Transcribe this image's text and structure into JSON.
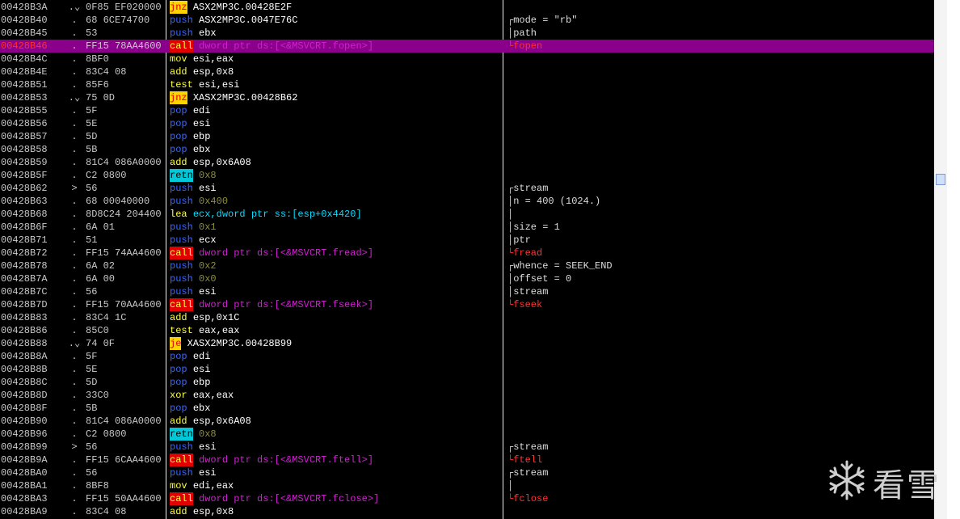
{
  "rows": [
    {
      "addr": "00428B3A",
      "mark": ".⌄",
      "hex": "0F85 EF020000",
      "mnemonic": "jnz",
      "kind": "jmp",
      "operands": "ASX2MP3C.00428E2F",
      "opclass": "plain",
      "comment": "",
      "cmtclass": ""
    },
    {
      "addr": "00428B40",
      "mark": ".",
      "hex": "68 6CE74700",
      "mnemonic": "push",
      "kind": "push",
      "operands": "ASX2MP3C.0047E76C",
      "opclass": "plain",
      "comment": "┌mode = \"rb\"",
      "cmtclass": "bracket"
    },
    {
      "addr": "00428B45",
      "mark": ".",
      "hex": "53",
      "mnemonic": "push",
      "kind": "push",
      "operands": "ebx",
      "opclass": "plain",
      "comment": "│path",
      "cmtclass": "bracket"
    },
    {
      "addr": "00428B46",
      "mark": ".",
      "hex": "FF15 78AA4600",
      "mnemonic": "call",
      "kind": "call",
      "operands": "dword ptr ds:[<&MSVCRT.fopen>]",
      "opclass": "call",
      "comment": "└fopen",
      "cmtclass": "func",
      "selected": true
    },
    {
      "addr": "00428B4C",
      "mark": ".",
      "hex": "8BF0",
      "mnemonic": "mov",
      "kind": "def",
      "operands": "esi,eax",
      "opclass": "plain",
      "comment": "",
      "cmtclass": ""
    },
    {
      "addr": "00428B4E",
      "mark": ".",
      "hex": "83C4 08",
      "mnemonic": "add",
      "kind": "def",
      "operands": "esp,0x8",
      "opclass": "plain",
      "comment": "",
      "cmtclass": ""
    },
    {
      "addr": "00428B51",
      "mark": ".",
      "hex": "85F6",
      "mnemonic": "test",
      "kind": "def",
      "operands": "esi,esi",
      "opclass": "plain",
      "comment": "",
      "cmtclass": ""
    },
    {
      "addr": "00428B53",
      "mark": ".⌄",
      "hex": "75 0D",
      "mnemonic": "jnz",
      "kind": "jmp",
      "operands": "XASX2MP3C.00428B62",
      "opclass": "plain",
      "comment": "",
      "cmtclass": ""
    },
    {
      "addr": "00428B55",
      "mark": ".",
      "hex": "5F",
      "mnemonic": "pop",
      "kind": "push",
      "operands": "edi",
      "opclass": "plain",
      "comment": "",
      "cmtclass": ""
    },
    {
      "addr": "00428B56",
      "mark": ".",
      "hex": "5E",
      "mnemonic": "pop",
      "kind": "push",
      "operands": "esi",
      "opclass": "plain",
      "comment": "",
      "cmtclass": ""
    },
    {
      "addr": "00428B57",
      "mark": ".",
      "hex": "5D",
      "mnemonic": "pop",
      "kind": "push",
      "operands": "ebp",
      "opclass": "plain",
      "comment": "",
      "cmtclass": ""
    },
    {
      "addr": "00428B58",
      "mark": ".",
      "hex": "5B",
      "mnemonic": "pop",
      "kind": "push",
      "operands": "ebx",
      "opclass": "plain",
      "comment": "",
      "cmtclass": ""
    },
    {
      "addr": "00428B59",
      "mark": ".",
      "hex": "81C4 086A0000",
      "mnemonic": "add",
      "kind": "def",
      "operands": "esp,0x6A08",
      "opclass": "plain",
      "comment": "",
      "cmtclass": ""
    },
    {
      "addr": "00428B5F",
      "mark": ".",
      "hex": "C2 0800",
      "mnemonic": "retn",
      "kind": "retn",
      "operands": "0x8",
      "opclass": "num",
      "comment": "",
      "cmtclass": ""
    },
    {
      "addr": "00428B62",
      "mark": ">",
      "hex": "56",
      "mnemonic": "push",
      "kind": "push",
      "operands": "esi",
      "opclass": "plain",
      "comment": "┌stream",
      "cmtclass": "bracket"
    },
    {
      "addr": "00428B63",
      "mark": ".",
      "hex": "68 00040000",
      "mnemonic": "push",
      "kind": "push",
      "operands": "0x400",
      "opclass": "num",
      "comment": "│n = 400 (1024.)",
      "cmtclass": "bracket"
    },
    {
      "addr": "00428B68",
      "mark": ".",
      "hex": "8D8C24 204400",
      "mnemonic": "lea",
      "kind": "def",
      "operands": "ecx,dword ptr ss:[esp+0x4420]",
      "opclass": "reg",
      "comment": "│",
      "cmtclass": "bracket"
    },
    {
      "addr": "00428B6F",
      "mark": ".",
      "hex": "6A 01",
      "mnemonic": "push",
      "kind": "push",
      "operands": "0x1",
      "opclass": "num",
      "comment": "│size = 1",
      "cmtclass": "bracket"
    },
    {
      "addr": "00428B71",
      "mark": ".",
      "hex": "51",
      "mnemonic": "push",
      "kind": "push",
      "operands": "ecx",
      "opclass": "plain",
      "comment": "│ptr",
      "cmtclass": "bracket"
    },
    {
      "addr": "00428B72",
      "mark": ".",
      "hex": "FF15 74AA4600",
      "mnemonic": "call",
      "kind": "call",
      "operands": "dword ptr ds:[<&MSVCRT.fread>]",
      "opclass": "call",
      "comment": "└fread",
      "cmtclass": "func"
    },
    {
      "addr": "00428B78",
      "mark": ".",
      "hex": "6A 02",
      "mnemonic": "push",
      "kind": "push",
      "operands": "0x2",
      "opclass": "num",
      "comment": "┌whence = SEEK_END",
      "cmtclass": "bracket"
    },
    {
      "addr": "00428B7A",
      "mark": ".",
      "hex": "6A 00",
      "mnemonic": "push",
      "kind": "push",
      "operands": "0x0",
      "opclass": "num",
      "comment": "│offset = 0",
      "cmtclass": "bracket"
    },
    {
      "addr": "00428B7C",
      "mark": ".",
      "hex": "56",
      "mnemonic": "push",
      "kind": "push",
      "operands": "esi",
      "opclass": "plain",
      "comment": "│stream",
      "cmtclass": "bracket"
    },
    {
      "addr": "00428B7D",
      "mark": ".",
      "hex": "FF15 70AA4600",
      "mnemonic": "call",
      "kind": "call",
      "operands": "dword ptr ds:[<&MSVCRT.fseek>]",
      "opclass": "call",
      "comment": "└fseek",
      "cmtclass": "func"
    },
    {
      "addr": "00428B83",
      "mark": ".",
      "hex": "83C4 1C",
      "mnemonic": "add",
      "kind": "def",
      "operands": "esp,0x1C",
      "opclass": "plain",
      "comment": "",
      "cmtclass": ""
    },
    {
      "addr": "00428B86",
      "mark": ".",
      "hex": "85C0",
      "mnemonic": "test",
      "kind": "def",
      "operands": "eax,eax",
      "opclass": "plain",
      "comment": "",
      "cmtclass": ""
    },
    {
      "addr": "00428B88",
      "mark": ".⌄",
      "hex": "74 0F",
      "mnemonic": "je",
      "kind": "jmp",
      "operands": "XASX2MP3C.00428B99",
      "opclass": "plain",
      "comment": "",
      "cmtclass": ""
    },
    {
      "addr": "00428B8A",
      "mark": ".",
      "hex": "5F",
      "mnemonic": "pop",
      "kind": "push",
      "operands": "edi",
      "opclass": "plain",
      "comment": "",
      "cmtclass": ""
    },
    {
      "addr": "00428B8B",
      "mark": ".",
      "hex": "5E",
      "mnemonic": "pop",
      "kind": "push",
      "operands": "esi",
      "opclass": "plain",
      "comment": "",
      "cmtclass": ""
    },
    {
      "addr": "00428B8C",
      "mark": ".",
      "hex": "5D",
      "mnemonic": "pop",
      "kind": "push",
      "operands": "ebp",
      "opclass": "plain",
      "comment": "",
      "cmtclass": ""
    },
    {
      "addr": "00428B8D",
      "mark": ".",
      "hex": "33C0",
      "mnemonic": "xor",
      "kind": "def",
      "operands": "eax,eax",
      "opclass": "plain",
      "comment": "",
      "cmtclass": ""
    },
    {
      "addr": "00428B8F",
      "mark": ".",
      "hex": "5B",
      "mnemonic": "pop",
      "kind": "push",
      "operands": "ebx",
      "opclass": "plain",
      "comment": "",
      "cmtclass": ""
    },
    {
      "addr": "00428B90",
      "mark": ".",
      "hex": "81C4 086A0000",
      "mnemonic": "add",
      "kind": "def",
      "operands": "esp,0x6A08",
      "opclass": "plain",
      "comment": "",
      "cmtclass": ""
    },
    {
      "addr": "00428B96",
      "mark": ".",
      "hex": "C2 0800",
      "mnemonic": "retn",
      "kind": "retn",
      "operands": "0x8",
      "opclass": "num",
      "comment": "",
      "cmtclass": ""
    },
    {
      "addr": "00428B99",
      "mark": ">",
      "hex": "56",
      "mnemonic": "push",
      "kind": "push",
      "operands": "esi",
      "opclass": "plain",
      "comment": "┌stream",
      "cmtclass": "bracket"
    },
    {
      "addr": "00428B9A",
      "mark": ".",
      "hex": "FF15 6CAA4600",
      "mnemonic": "call",
      "kind": "call",
      "operands": "dword ptr ds:[<&MSVCRT.ftell>]",
      "opclass": "call",
      "comment": "└ftell",
      "cmtclass": "func"
    },
    {
      "addr": "00428BA0",
      "mark": ".",
      "hex": "56",
      "mnemonic": "push",
      "kind": "push",
      "operands": "esi",
      "opclass": "plain",
      "comment": "┌stream",
      "cmtclass": "bracket"
    },
    {
      "addr": "00428BA1",
      "mark": ".",
      "hex": "8BF8",
      "mnemonic": "mov",
      "kind": "def",
      "operands": "edi,eax",
      "opclass": "plain",
      "comment": "│",
      "cmtclass": "bracket"
    },
    {
      "addr": "00428BA3",
      "mark": ".",
      "hex": "FF15 50AA4600",
      "mnemonic": "call",
      "kind": "call",
      "operands": "dword ptr ds:[<&MSVCRT.fclose>]",
      "opclass": "call",
      "comment": "└fclose",
      "cmtclass": "func"
    },
    {
      "addr": "00428BA9",
      "mark": ".",
      "hex": "83C4 08",
      "mnemonic": "add",
      "kind": "def",
      "operands": "esp,0x8",
      "opclass": "plain",
      "comment": "",
      "cmtclass": ""
    }
  ],
  "watermark": {
    "text": "看雪",
    "icon": "snowflake-icon"
  },
  "colors": {
    "background": "#000000",
    "selection": "#8a008a",
    "jmp_bg": "#ffd400",
    "call_bg": "#e00000",
    "retn_bg": "#00c8d8",
    "push": "#3a66ff",
    "call_operand": "#d020d0",
    "func_comment": "#ff3030"
  }
}
